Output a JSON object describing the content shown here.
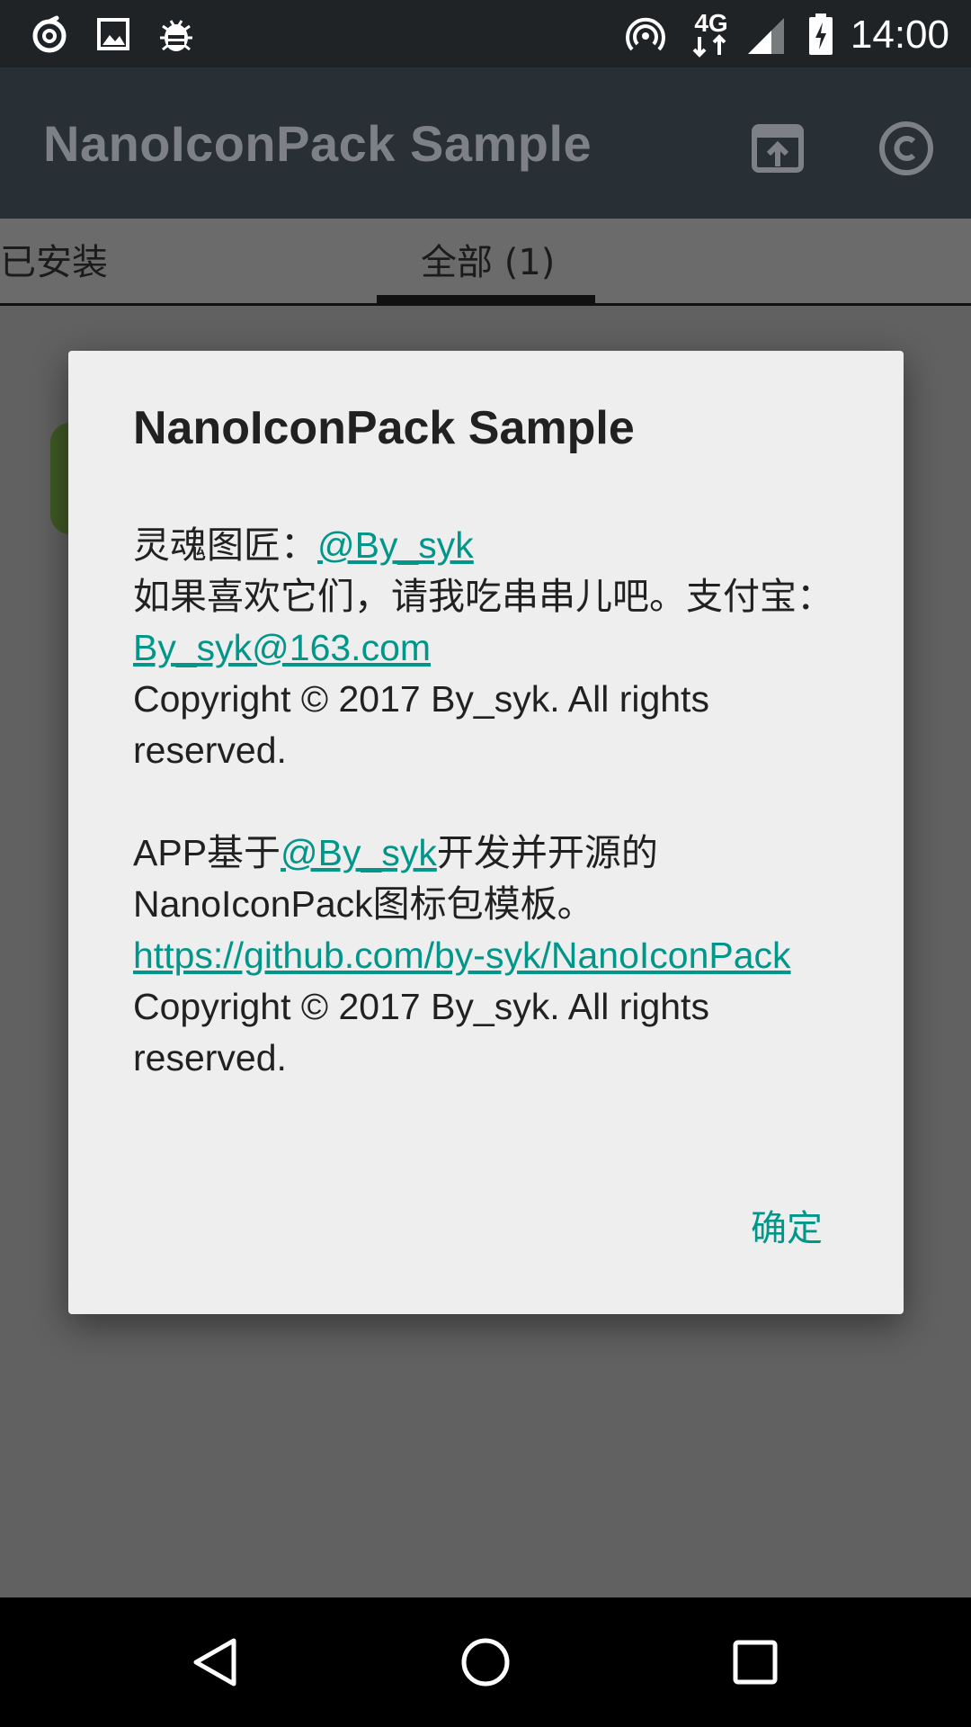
{
  "status_bar": {
    "time": "14:00",
    "network": "4G",
    "icons": [
      "netease-music-icon",
      "image-icon",
      "bug-icon",
      "hotspot-icon",
      "network-4g-icon",
      "signal-icon",
      "battery-charging-icon"
    ]
  },
  "app_bar": {
    "title": "NanoIconPack Sample",
    "icons": [
      "open-in-icon",
      "copyright-icon"
    ]
  },
  "tabs": [
    {
      "label": "已安装"
    },
    {
      "label": "全部 (1)"
    }
  ],
  "dialog": {
    "title": "NanoIconPack Sample",
    "line1_prefix": "灵魂图匠：",
    "line1_link": "@By_syk",
    "line2": "如果喜欢它们，请我吃串串儿吧。支付宝：",
    "line2_link": "By_syk@163.com",
    "copyright1": "Copyright © 2017 By_syk. All rights reserved.",
    "line3_prefix": "APP基于",
    "line3_link": "@By_syk",
    "line3_suffix": "开发并开源的NanoIconPack图标包模板。",
    "github_link": "https://github.com/by-syk/NanoIconPack",
    "copyright2": "Copyright © 2017 By_syk. All rights reserved.",
    "ok_button": "确定",
    "link_color": "#00968a"
  },
  "nav_bar": {
    "icons": [
      "back-icon",
      "home-icon",
      "recents-icon"
    ]
  }
}
